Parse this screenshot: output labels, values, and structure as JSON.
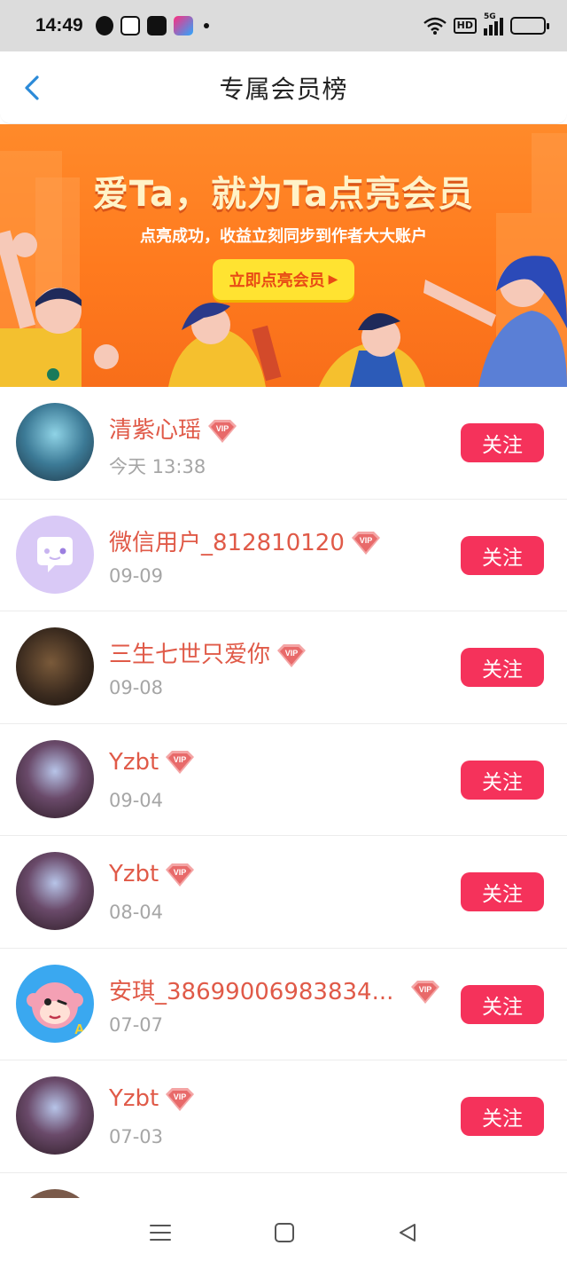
{
  "status_bar": {
    "time": "14:49",
    "network_label": "HD",
    "signal_label": "5G",
    "icons": [
      "qq-icon",
      "app-icon",
      "tiktok-icon",
      "youku-icon",
      "dot-icon",
      "wifi-icon",
      "signal-icon",
      "battery-icon"
    ]
  },
  "nav": {
    "title": "专属会员榜",
    "back_icon": "chevron-left-icon"
  },
  "banner": {
    "headline": "爱Ta，就为Ta点亮会员",
    "subline": "点亮成功，收益立刻同步到作者大大账户",
    "cta_label": "立即点亮会员"
  },
  "members": [
    {
      "name": "清紫心瑶",
      "date": "今天 13:38",
      "follow": "关注",
      "avatar": "anime-blue"
    },
    {
      "name": "微信用户_812810120",
      "date": "09-09",
      "follow": "关注",
      "avatar": "wechat-default"
    },
    {
      "name": "三生七世只爱你",
      "date": "09-08",
      "follow": "关注",
      "avatar": "dark-warrior"
    },
    {
      "name": "Yzbt",
      "date": "09-04",
      "follow": "关注",
      "avatar": "anime-red"
    },
    {
      "name": "Yzbt",
      "date": "08-04",
      "follow": "关注",
      "avatar": "anime-red"
    },
    {
      "name": "安琪_38699006983834...",
      "date": "07-07",
      "follow": "关注",
      "avatar": "monkey-cartoon"
    },
    {
      "name": "Yzbt",
      "date": "07-03",
      "follow": "关注",
      "avatar": "anime-red"
    }
  ],
  "vip_label": "VIP",
  "colors": {
    "accent": "#f5325b",
    "name": "#e05a48",
    "banner": "#ff7a1e",
    "cta": "#ffe331"
  },
  "bottom_nav": [
    "menu-icon",
    "home-square-icon",
    "back-triangle-icon"
  ]
}
